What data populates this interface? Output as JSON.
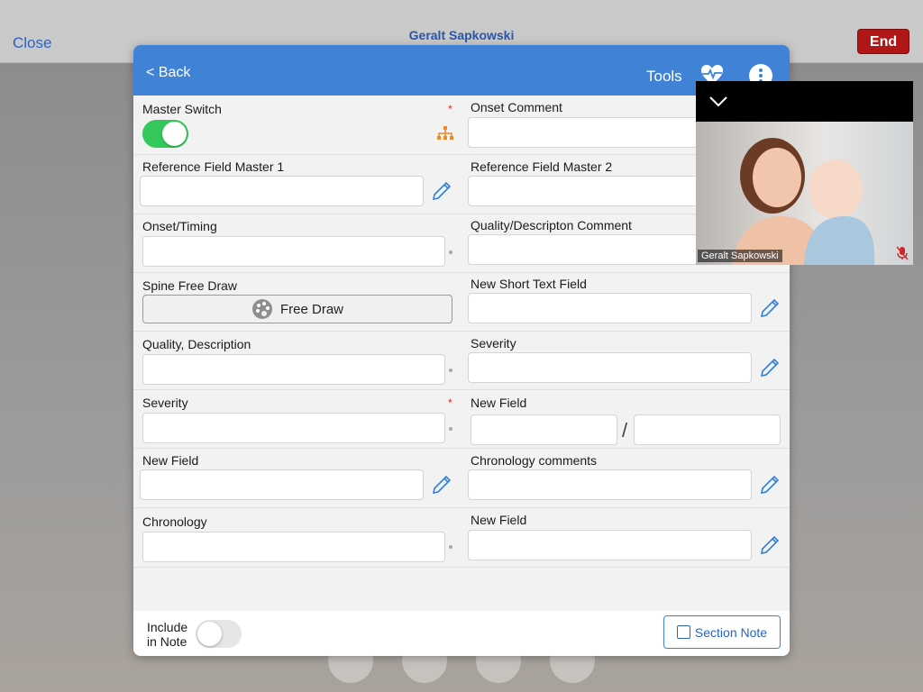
{
  "call": {
    "close_label": "Close",
    "caller_name": "Geralt Sapkowski",
    "end_label": "End"
  },
  "modal": {
    "back_label": "< Back",
    "tools_label": "Tools",
    "icons": {
      "heart": "heart-pulse-icon",
      "more": "more-vertical-icon"
    }
  },
  "fields": {
    "master_switch": {
      "label": "Master Switch",
      "required": "*",
      "on": true
    },
    "onset_comment": {
      "label": "Onset Comment",
      "value": ""
    },
    "ref_master_1": {
      "label": "Reference Field Master 1",
      "value": ""
    },
    "ref_master_2": {
      "label": "Reference Field Master 2",
      "value": ""
    },
    "onset_timing": {
      "label": "Onset/Timing",
      "value": ""
    },
    "quality_comment": {
      "label": "Quality/Descripton Comment",
      "value": ""
    },
    "spine_free_draw": {
      "label": "Spine Free Draw",
      "button": "Free Draw"
    },
    "new_short_text": {
      "label": "New Short Text Field",
      "value": ""
    },
    "quality_description": {
      "label": "Quality, Description",
      "value": ""
    },
    "severity_right": {
      "label": "Severity",
      "value": ""
    },
    "severity_left": {
      "label": "Severity",
      "required": "*",
      "value": ""
    },
    "new_field_ratio": {
      "label": "New Field",
      "separator": "/",
      "value_a": "",
      "value_b": ""
    },
    "new_field_left": {
      "label": "New Field",
      "value": ""
    },
    "chronology_comments": {
      "label": "Chronology comments",
      "value": ""
    },
    "chronology": {
      "label": "Chronology",
      "value": ""
    },
    "new_field_right": {
      "label": "New Field",
      "value": ""
    }
  },
  "footer": {
    "include_line1": "Include",
    "include_line2": "in Note",
    "include_on": false,
    "section_note_label": "Section Note"
  },
  "video": {
    "participant_name": "Geralt Sapkowski",
    "muted": true
  },
  "colors": {
    "header_blue": "#3f82d6",
    "toggle_green": "#34c759",
    "end_red": "#b01616",
    "pencil_blue": "#2f7fd8",
    "tree_orange": "#f08a1c"
  }
}
